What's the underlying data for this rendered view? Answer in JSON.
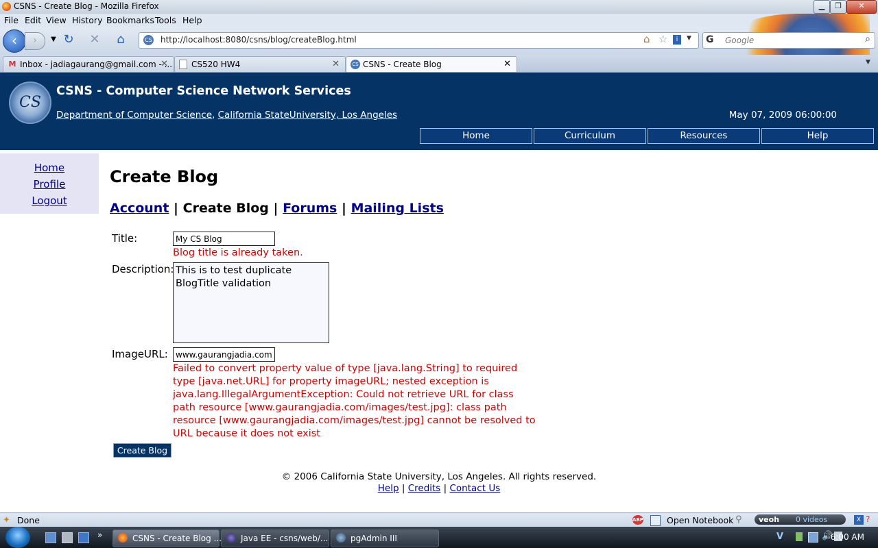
{
  "window": {
    "title": "CSNS - Create Blog - Mozilla Firefox"
  },
  "menubar": {
    "items": [
      "File",
      "Edit",
      "View",
      "History",
      "Bookmarks",
      "Tools",
      "Help"
    ]
  },
  "navbar": {
    "url": "http://localhost:8080/csns/blog/createBlog.html",
    "search_placeholder": "Google"
  },
  "tabs": [
    {
      "label": "Inbox - jadiagaurang@gmail.com - ...",
      "icon": "gmail-icon"
    },
    {
      "label": "CS520 HW4",
      "icon": "page-icon"
    },
    {
      "label": "CSNS - Create Blog",
      "icon": "csns-icon",
      "active": true
    }
  ],
  "header": {
    "logo_text": "CS",
    "title": "CSNS - Computer Science Network Services",
    "dept_link": "Department of Computer Science",
    "separator": ",",
    "univ_link": "California StateUniversity, Los Angeles",
    "datetime": "May 07, 2009 06:00:00",
    "nav": [
      "Home",
      "Curriculum",
      "Resources",
      "Help"
    ]
  },
  "sidebar": {
    "links": [
      "Home",
      "Profile",
      "Logout"
    ]
  },
  "main": {
    "page_title": "Create Blog",
    "subnav": {
      "account": "Account",
      "current": "Create Blog",
      "forums": "Forums",
      "mailing": "Mailing Lists",
      "sep": "|"
    },
    "form": {
      "title_label": "Title:",
      "title_value": "My CS Blog",
      "title_error": "Blog title is already taken.",
      "desc_label": "Description:",
      "desc_value": "This is to test duplicate BlogTitle validation",
      "image_label": "ImageURL:",
      "image_value": "www.gaurangjadia.com/images/test.jpg",
      "image_error": "Failed to convert property value of type [java.lang.String] to required type [java.net.URL] for property imageURL; nested exception is java.lang.IllegalArgumentException: Could not retrieve URL for class path resource [www.gaurangjadia.com/images/test.jpg]: class path resource [www.gaurangjadia.com/images/test.jpg] cannot be resolved to URL because it does not exist",
      "submit_label": "Create Blog"
    }
  },
  "footer": {
    "copyright": "© 2006 California State University, Los Angeles. All rights reserved.",
    "links": [
      "Help",
      "Credits",
      "Contact Us"
    ],
    "sep": "|"
  },
  "statusbar": {
    "text": "Done",
    "notebook": "Open Notebook",
    "videos": "0 videos"
  },
  "taskbar": {
    "tasks": [
      "CSNS - Create Blog ...",
      "Java EE - csns/web/...",
      "pgAdmin III"
    ],
    "clock": "6:00 AM"
  },
  "colors": {
    "header_bg": "#063366",
    "link": "#00008b",
    "error": "#d40000",
    "sidebar_bg": "#e4e4f5"
  }
}
